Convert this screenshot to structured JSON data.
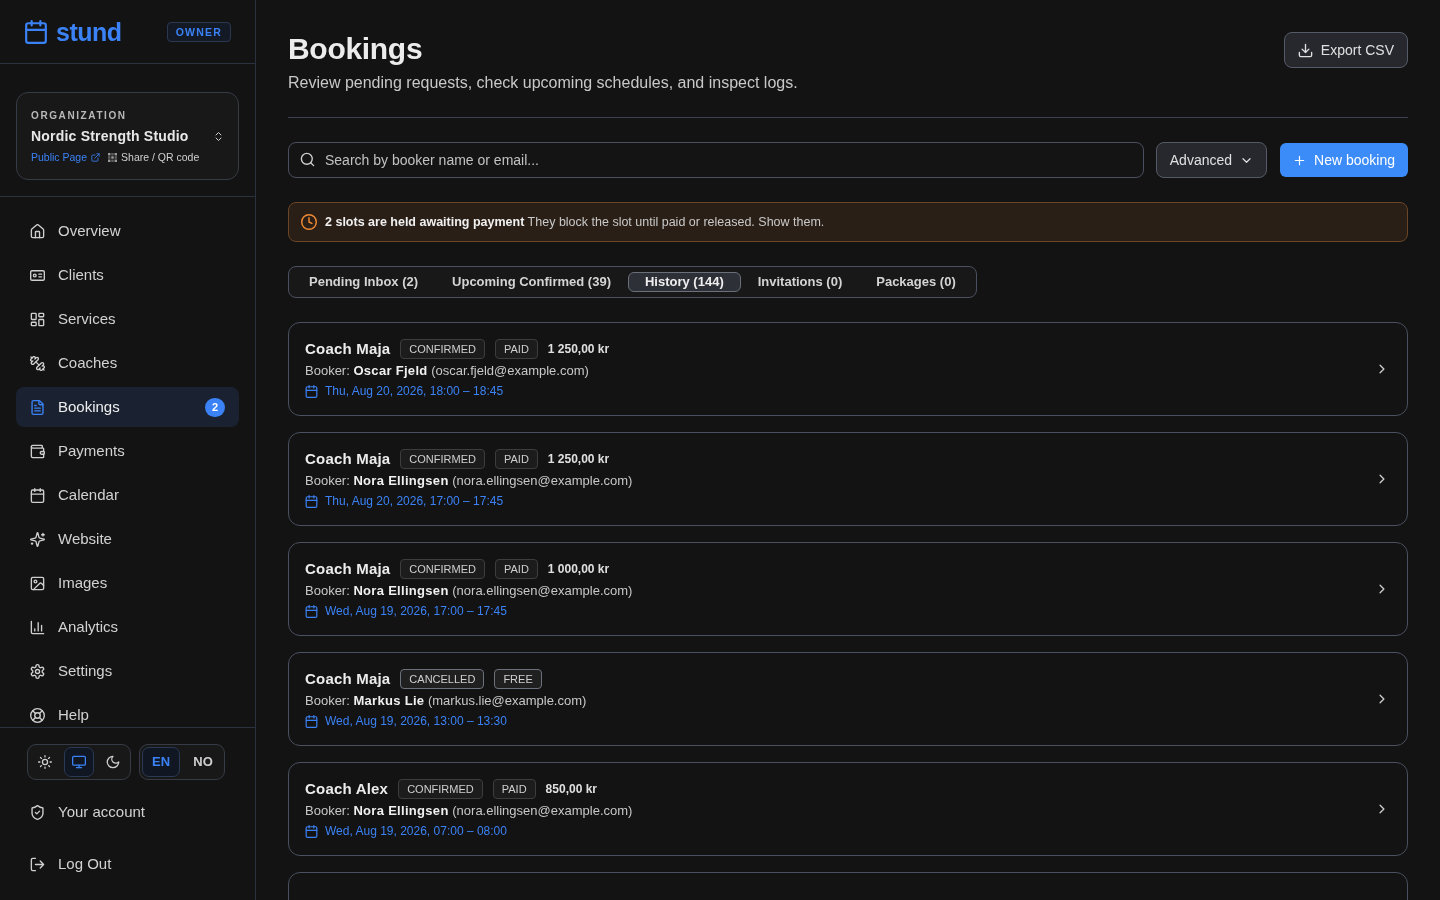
{
  "brand": {
    "name": "stund",
    "role": "OWNER"
  },
  "organization": {
    "label": "ORGANIZATION",
    "name": "Nordic Strength Studio",
    "public_link": "Public Page",
    "share_link": "Share / QR code"
  },
  "nav": [
    {
      "label": "Overview",
      "selected": false
    },
    {
      "label": "Clients",
      "selected": false
    },
    {
      "label": "Services",
      "selected": false
    },
    {
      "label": "Coaches",
      "selected": false
    },
    {
      "label": "Bookings",
      "selected": true,
      "badge": "2"
    },
    {
      "label": "Payments",
      "selected": false
    },
    {
      "label": "Calendar",
      "selected": false
    },
    {
      "label": "Website",
      "selected": false
    },
    {
      "label": "Images",
      "selected": false
    },
    {
      "label": "Analytics",
      "selected": false
    },
    {
      "label": "Settings",
      "selected": false
    },
    {
      "label": "Help",
      "selected": false
    }
  ],
  "theme_toggle": [
    {
      "selected": false
    },
    {
      "selected": true
    },
    {
      "selected": false
    }
  ],
  "language": [
    {
      "label": "EN",
      "selected": true
    },
    {
      "label": "NO",
      "selected": false
    }
  ],
  "account_links": [
    "Your account",
    "Log Out"
  ],
  "header": {
    "title": "Bookings",
    "subtitle": "Review pending requests, check upcoming schedules, and inspect logs.",
    "export_button": "Export CSV"
  },
  "toolbar": {
    "search": {
      "placeholder": "Search by booker name or email..."
    },
    "advanced_button": "Advanced",
    "new_button": "New booking"
  },
  "alert": {
    "text": "**2 slots are held awaiting payment** They block the slot until paid or released. Show them."
  },
  "tabs": [
    {
      "label": "Pending Inbox (2)",
      "selected": false
    },
    {
      "label": "Upcoming Confirmed (39)",
      "selected": false
    },
    {
      "label": "History (144)",
      "selected": true
    },
    {
      "label": "Invitations (0)",
      "selected": false
    },
    {
      "label": "Packages (0)",
      "selected": false
    }
  ],
  "bookings": [
    {
      "coach": "Coach Maja",
      "status": "CONFIRMED",
      "payment": "PAID",
      "amount": "1 250,00 kr",
      "cancelled": false,
      "booker": "Booker: **Oscar Fjeld** (oscar.fjeld@example.com)",
      "time": "Thu, Aug 20, 2026, 18:00 – 18:45"
    },
    {
      "coach": "Coach Maja",
      "status": "CONFIRMED",
      "payment": "PAID",
      "amount": "1 250,00 kr",
      "cancelled": false,
      "booker": "Booker: **Nora Ellingsen** (nora.ellingsen@example.com)",
      "time": "Thu, Aug 20, 2026, 17:00 – 17:45"
    },
    {
      "coach": "Coach Maja",
      "status": "CONFIRMED",
      "payment": "PAID",
      "amount": "1 000,00 kr",
      "cancelled": false,
      "booker": "Booker: **Nora Ellingsen** (nora.ellingsen@example.com)",
      "time": "Wed, Aug 19, 2026, 17:00 – 17:45"
    },
    {
      "coach": "Coach Maja",
      "status": "CANCELLED",
      "payment": "FREE",
      "cancelled": true,
      "booker": "Booker: **Markus Lie** (markus.lie@example.com)",
      "time": "Wed, Aug 19, 2026, 13:00 – 13:30"
    },
    {
      "coach": "Coach Alex",
      "status": "CONFIRMED",
      "payment": "PAID",
      "amount": "850,00 kr",
      "cancelled": false,
      "booker": "Booker: **Nora Ellingsen** (nora.ellingsen@example.com)",
      "time": "Wed, Aug 19, 2026, 07:00 – 08:00"
    }
  ],
  "bookings_more_below": true
}
